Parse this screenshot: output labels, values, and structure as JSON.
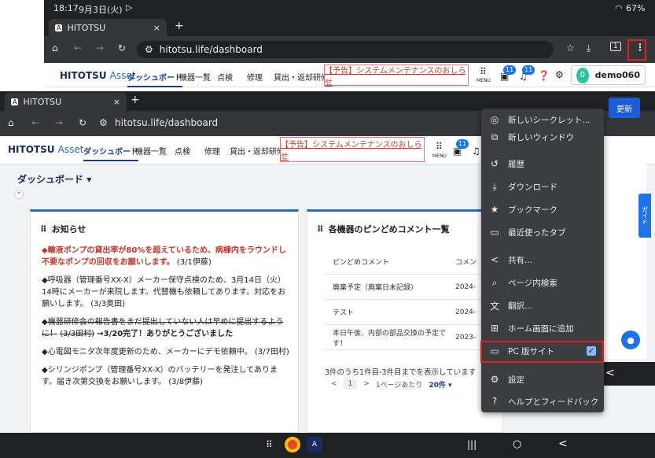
{
  "status1": {
    "time": "18:17",
    "date": "9月3日(火)",
    "battery": "67%"
  },
  "tab": {
    "title": "HITOTSU",
    "close": "×",
    "new": "+"
  },
  "address": {
    "url": "hitotsu.life/dashboard"
  },
  "appnav": {
    "brand_main": "HITOTSU",
    "brand_sub": "Asset",
    "links": [
      "ダッシュボード",
      "機器一覧",
      "点検",
      "修理",
      "貸出・返却",
      "研修"
    ],
    "notice": "【予告】システムメンテナンスのおしらせ",
    "menu_label": "MENU",
    "badge1": "11",
    "badge2": "11",
    "user_initial": "0",
    "user_name": "demo060",
    "update_btn": "更新"
  },
  "page": {
    "title": "ダッシュボード",
    "side_tab": "ガイド"
  },
  "news": {
    "title": "お知らせ",
    "items": [
      {
        "text": "◆輸液ポンプの貸出率が80%を超えているため、病棟内をラウンドし不要なポンプの回収をお願いします。",
        "meta": "(3/1伊藤)"
      },
      {
        "text": "◆呼吸器（管理番号XX-X）メーカー保守点検のため、3月14日（火）14時にメーカーが来院します。代替機も依頼してあります。対応をお願いします。",
        "meta": "(3/3奥田)"
      },
      {
        "text": "◆機器研修会の報告書をまだ提出していない人は早めに提出するように！",
        "meta": "(3/3田村)",
        "after": "→3/20完了！ありがとうございました"
      },
      {
        "text": "◆心電図モニタ次年度更新のため、メーカーにデモ依頼中。",
        "meta": "(3/7田村)"
      },
      {
        "text": "◆シリンジポンプ（管理番号XX-X）のバッテリーを発注してあります。届き次第交換をお願いします。",
        "meta": "(3/8伊藤)"
      }
    ]
  },
  "pins": {
    "title": "各機器のピンどめコメント一覧",
    "headers": [
      "ピンどめコメント",
      "コメン"
    ],
    "rows": [
      [
        "廃棄予定（廃棄日未記録）",
        "2024-"
      ],
      [
        "テスト",
        "2024-"
      ],
      [
        "本日午後、内部の部品交換の予定です！",
        "2023-"
      ]
    ],
    "summary": "3件のうち1件目-3件目までを表示しています",
    "page": "1",
    "per_page_label": "1ページあたり",
    "per_page_value": "20件"
  },
  "menu": {
    "items": [
      {
        "icon": "incognito-icon",
        "glyph": "◎",
        "label": "新しいシークレット..."
      },
      {
        "icon": "new-window-icon",
        "glyph": "⧉",
        "label": "新しいウィンドウ"
      },
      {
        "icon": "history-icon",
        "glyph": "↺",
        "label": "履歴"
      },
      {
        "icon": "download-icon",
        "glyph": "⤓",
        "label": "ダウンロード"
      },
      {
        "icon": "bookmark-icon",
        "glyph": "★",
        "label": "ブックマーク"
      },
      {
        "icon": "recent-tabs-icon",
        "glyph": "▭",
        "label": "最近使ったタブ"
      },
      {
        "icon": "share-icon",
        "glyph": "<",
        "label": "共有..."
      },
      {
        "icon": "find-icon",
        "glyph": "⌕",
        "label": "ページ内検索"
      },
      {
        "icon": "translate-icon",
        "glyph": "文",
        "label": "翻訳..."
      },
      {
        "icon": "add-home-icon",
        "glyph": "⊞",
        "label": "ホーム画面に追加"
      },
      {
        "icon": "desktop-icon",
        "glyph": "▭",
        "label": "PC 版サイト"
      },
      {
        "icon": "settings-icon",
        "glyph": "⚙",
        "label": "設定"
      },
      {
        "icon": "help-icon",
        "glyph": "?",
        "label": "ヘルプとフィードバック"
      }
    ]
  }
}
